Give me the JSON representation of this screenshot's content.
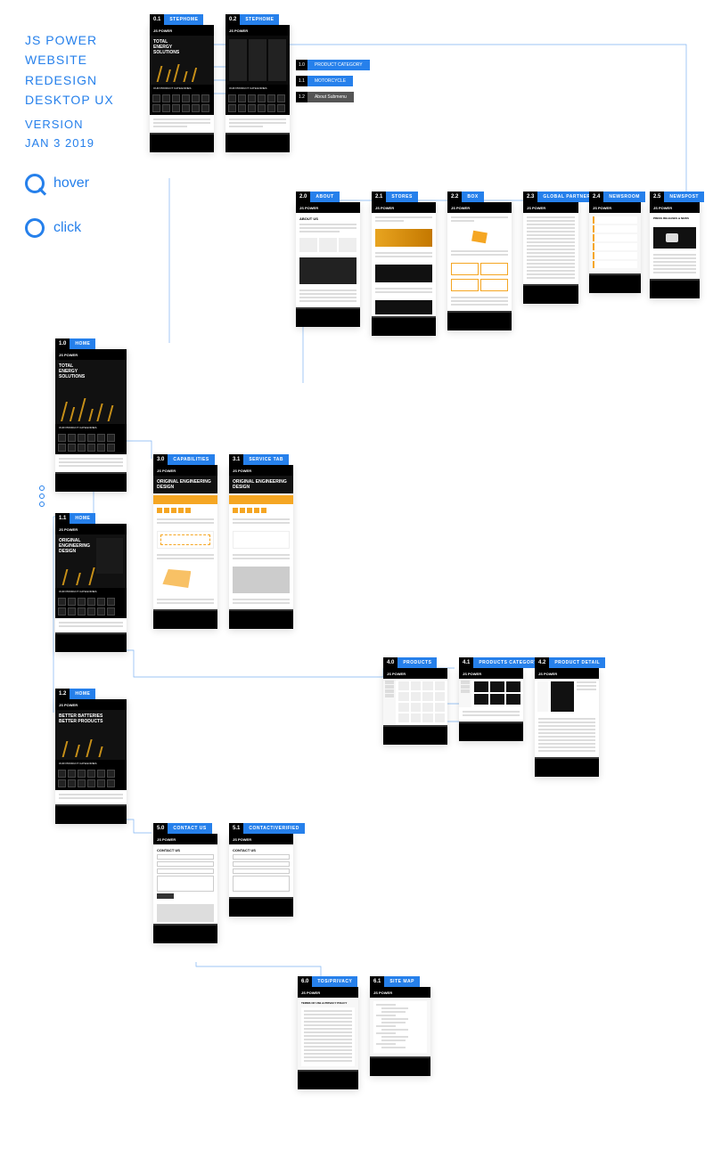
{
  "title_line1": "JS POWER",
  "title_line2": "WEBSITE",
  "title_line3": "REDESIGN",
  "title_line4": "DESKTOP UX",
  "version_line1": "VERSION",
  "version_line2": "JAN 3 2019",
  "legend": {
    "hover": "hover",
    "click": "click"
  },
  "logo": "JS POWER",
  "heroes": {
    "energy": "TOTAL\nENERGY\nSOLUTIONS",
    "original": "ORIGINAL\nENGINEERING\nDESIGN",
    "better": "BETTER BATTERIES\nBETTER PRODUCTS",
    "service_hero": "ORIGINAL ENGINEERING DESIGN"
  },
  "tags": {
    "t01": {
      "num": "0.1",
      "label": "STEPHOME"
    },
    "t02": {
      "num": "0.2",
      "label": "STEPHOME"
    },
    "t10": {
      "num": "1.0",
      "label": "HOME"
    },
    "t11": {
      "num": "1.1",
      "label": "HOME"
    },
    "t12": {
      "num": "1.2",
      "label": "HOME"
    },
    "t20": {
      "num": "2.0",
      "label": "ABOUT"
    },
    "t21": {
      "num": "2.1",
      "label": "STORES"
    },
    "t22": {
      "num": "2.2",
      "label": "BOX"
    },
    "t23": {
      "num": "2.3",
      "label": "GLOBAL PARTNERS"
    },
    "t24": {
      "num": "2.4",
      "label": "NEWSROOM"
    },
    "t25": {
      "num": "2.5",
      "label": "NEWSPOST"
    },
    "t30": {
      "num": "3.0",
      "label": "CAPABILITIES"
    },
    "t31": {
      "num": "3.1",
      "label": "SERVICE TAB"
    },
    "t40": {
      "num": "4.0",
      "label": "PRODUCTS"
    },
    "t41": {
      "num": "4.1",
      "label": "PRODUCTS CATEGORY"
    },
    "t42": {
      "num": "4.2",
      "label": "PRODUCT DETAIL"
    },
    "t50": {
      "num": "5.0",
      "label": "CONTACT US"
    },
    "t51": {
      "num": "5.1",
      "label": "CONTACT/VERIFIED"
    },
    "t60": {
      "num": "6.0",
      "label": "TOS/PRIVACY"
    },
    "t61": {
      "num": "6.1",
      "label": "SITE MAP"
    }
  },
  "dropdown": {
    "d1": {
      "num": "1.0",
      "label": "PRODUCT CATEGORY"
    },
    "d2": {
      "num": "1.1",
      "label": "MOTORCYCLE"
    },
    "d3": {
      "num": "1.2",
      "label": "About Submenu"
    }
  },
  "about": {
    "heading": "ABOUT US"
  },
  "contact": {
    "heading": "CONTACT US"
  },
  "news": {
    "heading": "PRESS RELEASES & NEWS"
  },
  "tos": {
    "heading": "TERMS OF USE & PRIVACY POLICY"
  }
}
